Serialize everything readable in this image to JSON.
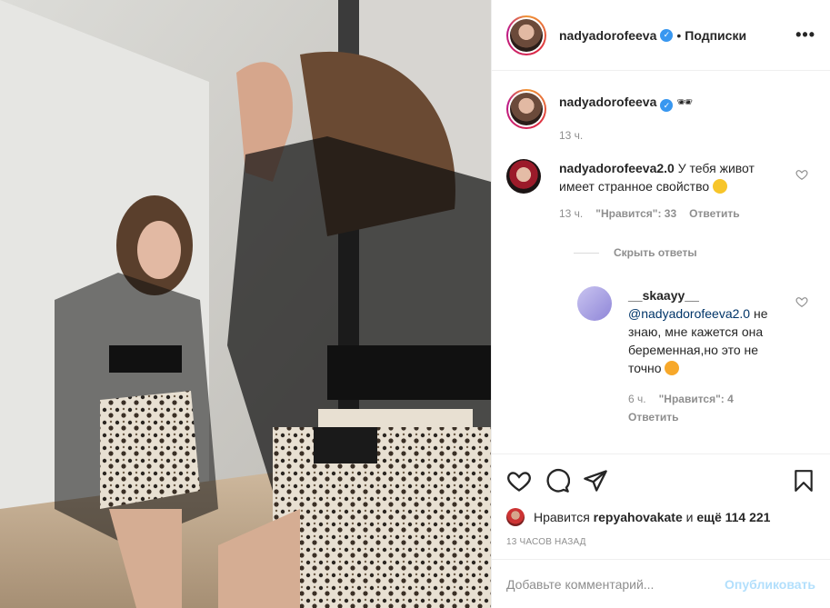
{
  "post": {
    "author": "nadyadorofeeva",
    "separator": "•",
    "follow_status": "Подписки",
    "more": "•••"
  },
  "caption": {
    "author": "nadyadorofeeva",
    "emoji": "🕶",
    "time": "13 ч."
  },
  "comments": [
    {
      "author": "nadyadorofeeva2.0",
      "text": "У тебя живот имеет странное свойство",
      "time": "13 ч.",
      "likes": "\"Нравится\": 33",
      "reply": "Ответить"
    }
  ],
  "hide_replies": "Скрыть ответы",
  "replies": [
    {
      "author": "__skaayy__",
      "mention": "@nadyadorofeeva2.0",
      "text": " не знаю, мне кажется она беременная,но это не точно",
      "time": "6 ч.",
      "likes": "\"Нравится\": 4",
      "reply": "Ответить"
    }
  ],
  "likes_line": {
    "prefix": "Нравится",
    "user": "repyahovakate",
    "middle": "и",
    "rest": "ещё 114 221"
  },
  "time_ago": "13 ЧАСОВ НАЗАД",
  "add_comment": {
    "placeholder": "Добавьте комментарий...",
    "publish": "Опубликовать"
  },
  "icons": {
    "verified": "verified-badge-icon",
    "like": "heart-icon",
    "comment": "comment-icon",
    "share": "paper-plane-icon",
    "save": "bookmark-icon"
  },
  "colors": {
    "verified": "#3897f0",
    "muted": "#8e8e8e",
    "publish": "#b2dffc",
    "mention": "#003569"
  }
}
